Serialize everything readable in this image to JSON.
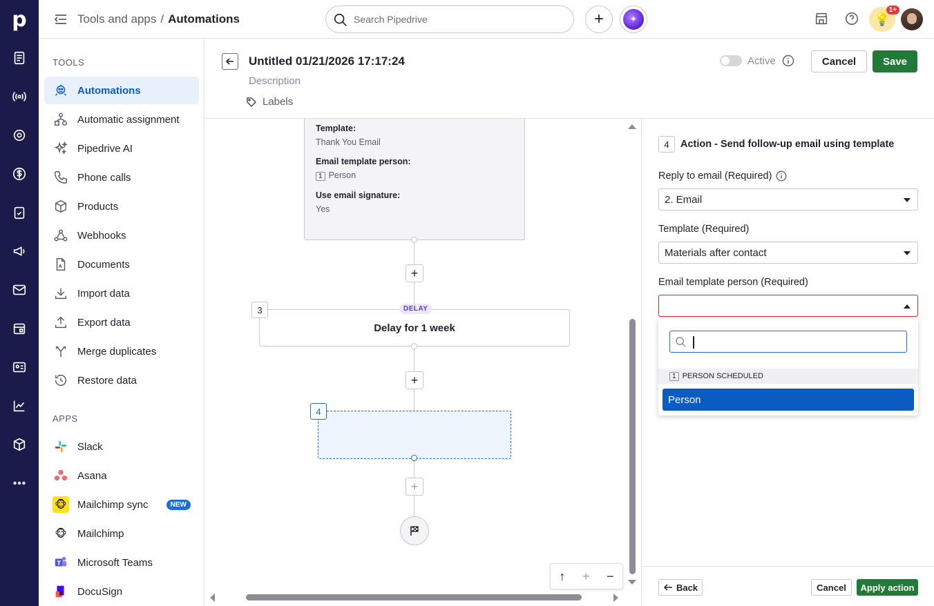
{
  "topbar": {
    "breadcrumb_parent": "Tools and apps",
    "breadcrumb_sep": "/",
    "breadcrumb_current": "Automations",
    "search_placeholder": "Search Pipedrive",
    "notifications_badge": "1+"
  },
  "rail": {
    "logo": "p"
  },
  "sidebar": {
    "tools_title": "TOOLS",
    "tools": [
      {
        "label": "Automations",
        "icon": "robot-icon"
      },
      {
        "label": "Automatic assignment",
        "icon": "assignment-icon"
      },
      {
        "label": "Pipedrive AI",
        "icon": "sparkle-icon"
      },
      {
        "label": "Phone calls",
        "icon": "phone-icon"
      },
      {
        "label": "Products",
        "icon": "box-icon"
      },
      {
        "label": "Webhooks",
        "icon": "webhook-icon"
      },
      {
        "label": "Documents",
        "icon": "document-icon"
      },
      {
        "label": "Import data",
        "icon": "download-icon"
      },
      {
        "label": "Export data",
        "icon": "upload-icon"
      },
      {
        "label": "Merge duplicates",
        "icon": "merge-icon"
      },
      {
        "label": "Restore data",
        "icon": "restore-icon"
      }
    ],
    "apps_title": "APPS",
    "apps": [
      {
        "label": "Slack"
      },
      {
        "label": "Asana"
      },
      {
        "label": "Mailchimp sync",
        "badge": "NEW"
      },
      {
        "label": "Mailchimp"
      },
      {
        "label": "Microsoft Teams"
      },
      {
        "label": "DocuSign"
      }
    ]
  },
  "editor": {
    "title": "Untitled 01/21/2026 17:17:24",
    "description": "Description",
    "labels": "Labels",
    "active_label": "Active",
    "cancel": "Cancel",
    "save": "Save"
  },
  "canvas": {
    "card1": {
      "template_key": "Template:",
      "template_val": "Thank You Email",
      "person_key": "Email template person:",
      "person_chip": "1",
      "person_val": "Person",
      "sig_key": "Use email signature:",
      "sig_val": "Yes"
    },
    "step3": {
      "num": "3",
      "badge": "DELAY",
      "text": "Delay for 1 week"
    },
    "step4": {
      "num": "4"
    }
  },
  "panel": {
    "step_num": "4",
    "title": "Action - Send follow-up email using template",
    "reply_label": "Reply to email (Required)",
    "reply_value": "2. Email",
    "template_label": "Template (Required)",
    "template_value": "Materials after contact",
    "person_label": "Email template person (Required)",
    "dropdown_group_num": "1",
    "dropdown_group": "PERSON SCHEDULED",
    "dropdown_option": "Person",
    "back": "Back",
    "cancel": "Cancel",
    "apply": "Apply action"
  },
  "colors": {
    "rail": "#1a1a4b",
    "accent": "#0a5cc2",
    "save_green": "#237a38",
    "error_red": "#c62e2e"
  }
}
